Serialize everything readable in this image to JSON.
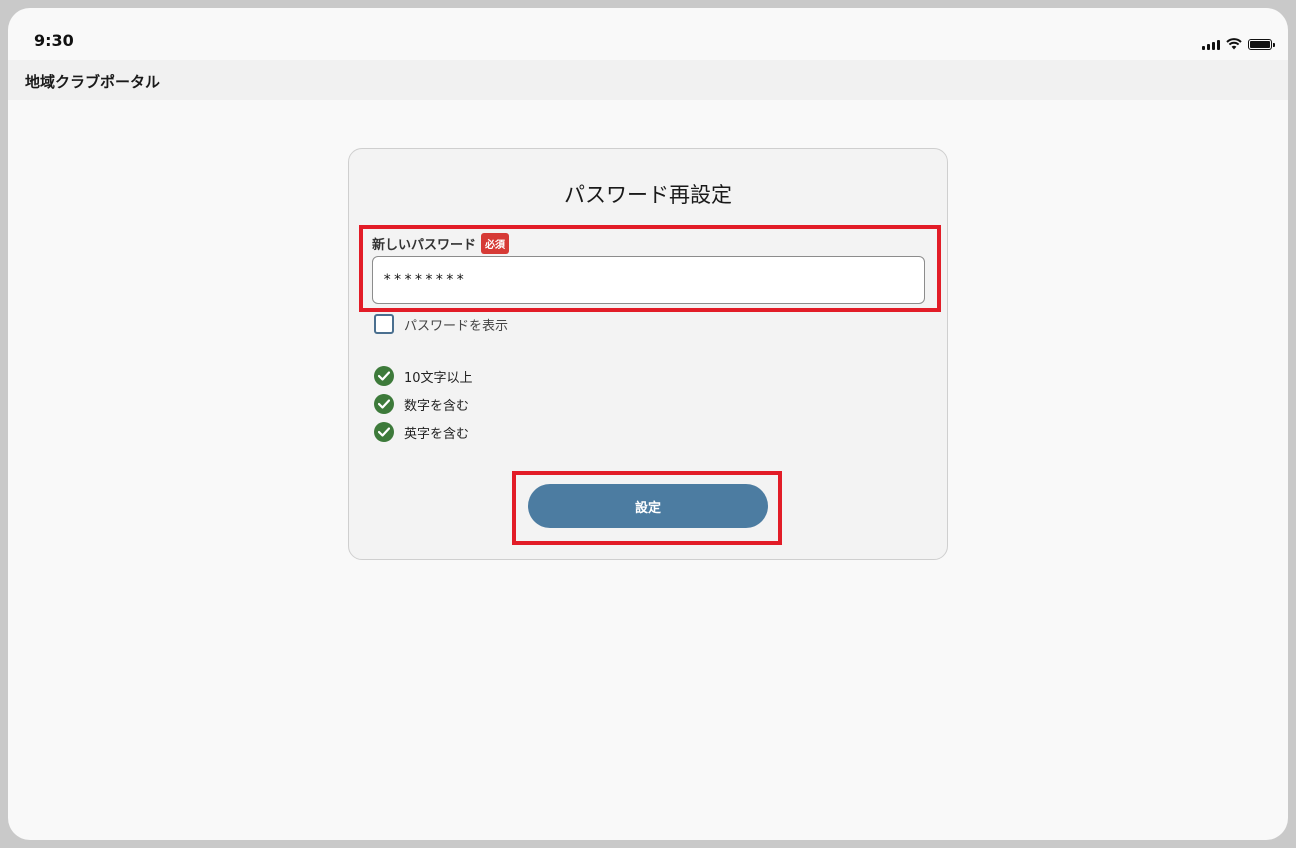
{
  "status_bar": {
    "time": "9:30"
  },
  "header": {
    "title": "地域クラブポータル"
  },
  "form": {
    "title": "パスワード再設定",
    "password_label": "新しいパスワード",
    "required_badge": "必須",
    "password_value": "********",
    "show_password_label": "パスワードを表示",
    "show_password_checked": false,
    "rules": [
      {
        "label": "10文字以上",
        "satisfied": true
      },
      {
        "label": "数字を含む",
        "satisfied": true
      },
      {
        "label": "英字を含む",
        "satisfied": true
      }
    ],
    "submit_label": "設定"
  },
  "colors": {
    "accent": "#4c7ca1",
    "success": "#3d7a3a",
    "required": "#d63a36",
    "highlight": "#e21c27"
  }
}
